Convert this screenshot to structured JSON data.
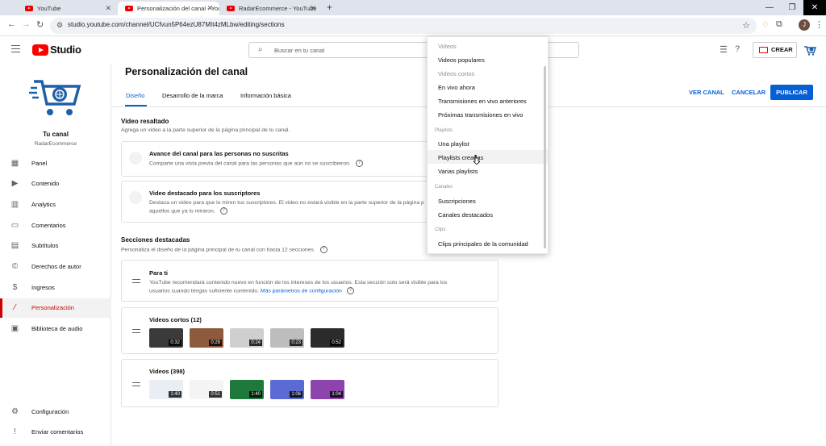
{
  "browser": {
    "tabs": [
      {
        "title": "YouTube"
      },
      {
        "title": "Personalización del canal - YouTu"
      },
      {
        "title": "RadarEcommerce - YouTube"
      }
    ],
    "url": "studio.youtube.com/channel/UCfvun5P64ezU87MIt4zMLbw/editing/sections"
  },
  "header": {
    "logo_text": "Studio",
    "search_placeholder": "Buscar en tu canal",
    "create_label": "CREAR"
  },
  "sidebar": {
    "channel_name": "Tu canal",
    "channel_handle": "RadarEcommerce",
    "items": [
      {
        "label": "Panel",
        "icon": "grid-icon"
      },
      {
        "label": "Contenido",
        "icon": "video-icon"
      },
      {
        "label": "Analytics",
        "icon": "analytics-icon"
      },
      {
        "label": "Comentarios",
        "icon": "comment-icon"
      },
      {
        "label": "Subtítulos",
        "icon": "subtitles-icon"
      },
      {
        "label": "Derechos de autor",
        "icon": "copyright-icon"
      },
      {
        "label": "Ingresos",
        "icon": "dollar-icon"
      },
      {
        "label": "Personalización",
        "icon": "magic-wand-icon"
      },
      {
        "label": "Biblioteca de audio",
        "icon": "audio-library-icon"
      }
    ],
    "bottom_items": [
      {
        "label": "Configuración",
        "icon": "gear-icon"
      },
      {
        "label": "Enviar comentarios",
        "icon": "feedback-icon"
      }
    ]
  },
  "main": {
    "title": "Personalización del canal",
    "tabs": [
      {
        "label": "Diseño"
      },
      {
        "label": "Desarrollo de la marca"
      },
      {
        "label": "Información básica"
      }
    ],
    "actions": {
      "view": "VER CANAL",
      "cancel": "CANCELAR",
      "publish": "PUBLICAR"
    },
    "featured_video": {
      "title": "Video resaltado",
      "desc": "Agrega un video a la parte superior de la página principal de tu canal.",
      "card1": {
        "title": "Avance del canal para las personas no suscritas",
        "text": "Comparte una vista previa del canal para las personas que aún no se suscribieron."
      },
      "card2": {
        "title": "Video destacado para los suscriptores",
        "text": "Destaca un video para que lo miren tus suscriptores. El video no estará visible en la parte superior de la página p",
        "text2": "aquellos que ya lo miraron."
      }
    },
    "sections": {
      "title": "Secciones destacadas",
      "desc": "Personaliza el diseño de la página principal de tu canal con hasta 12 secciones.",
      "para_ti": {
        "title": "Para ti",
        "text": "YouTube recomendará contenido nuevo en función de los intereses de los usuarios. Esta sección solo será visible para los",
        "text2": "usuarios cuando tengas suficiente contenido.",
        "link": "Más parámetros de configuración"
      },
      "shorts": {
        "title": "Videos cortos (12)",
        "durations": [
          "0:32",
          "0:29",
          "0:24",
          "0:23",
          "0:52"
        ],
        "colors": [
          "#3a3a3a",
          "#8d5a3b",
          "#cfcfcf",
          "#bdbdbd",
          "#2b2b2b"
        ]
      },
      "videos": {
        "title": "Videos (398)",
        "durations": [
          "1:40",
          "0:51",
          "1:40",
          "1:06",
          "1:04"
        ],
        "colors": [
          "#e9eef5",
          "#f4f4f4",
          "#1e7a3c",
          "#5a6bd6",
          "#8e44ad"
        ]
      }
    }
  },
  "dropdown": {
    "items": [
      {
        "label": "Videos",
        "disabled": true
      },
      {
        "label": "Videos populares",
        "disabled": false
      },
      {
        "label": "Videos cortos",
        "disabled": true
      },
      {
        "label": "En vivo ahora",
        "disabled": false
      },
      {
        "label": "Transmisiones en vivo anteriores",
        "disabled": false
      },
      {
        "label": "Próximas transmisiones en vivo",
        "disabled": false
      }
    ],
    "playlists_header": "Playlists",
    "playlist_items": [
      {
        "label": "Una playlist"
      },
      {
        "label": "Playlists creadas"
      },
      {
        "label": "Varias playlists"
      }
    ],
    "channels_header": "Canales",
    "channel_items": [
      {
        "label": "Suscripciones"
      },
      {
        "label": "Canales destacados"
      }
    ],
    "clips_header": "Clips",
    "clip_items": [
      {
        "label": "Clips principales de la comunidad"
      }
    ]
  },
  "colors": {
    "accent": "#065fd4",
    "brand": "#ff0000",
    "active": "#cc0000"
  }
}
